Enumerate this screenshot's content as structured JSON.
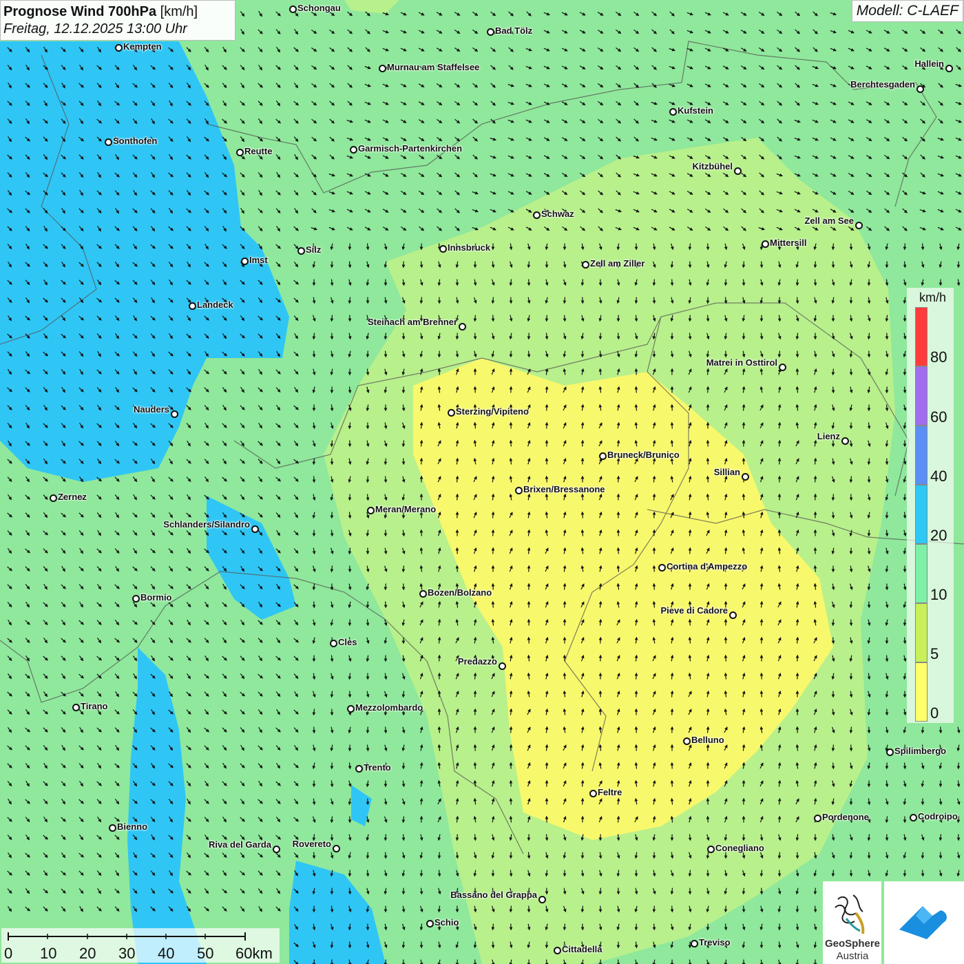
{
  "header": {
    "title": "Prognose Wind 700hPa",
    "unit": "[km/h]",
    "subtitle": "Freitag, 12.12.2025 13:00 Uhr",
    "model": "Modell: C-LAEF"
  },
  "legend": {
    "unit": "km/h",
    "ticks": [
      "80",
      "60",
      "40",
      "20",
      "10",
      "5",
      "0"
    ],
    "colors": [
      "#ff3b3b",
      "#a06cf0",
      "#5b8ff5",
      "#2ec8f5",
      "#7ef0a8",
      "#c8f05a",
      "#ffff6a"
    ]
  },
  "scale": {
    "labels": [
      "0",
      "10",
      "20",
      "30",
      "40",
      "50",
      "60km"
    ]
  },
  "logos": {
    "geosphere_line1": "GeoSphere",
    "geosphere_line2": "Austria",
    "geosphere_icon": "geosphere-logo-icon",
    "app_icon": "cloud-arrow-logo-icon"
  },
  "fields": {
    "colors": {
      "blue": "#2fc6f5",
      "green": "#8fe89b",
      "lightgreen": "#b8f08c",
      "yellow": "#f8f86c"
    }
  },
  "cities": [
    "Schongau",
    "Bad Tölz",
    "Kempten",
    "Murnau am Staffelsee",
    "Hallein",
    "Berchtesgaden",
    "Kufstein",
    "Sonthofen",
    "Reutte",
    "Garmisch-Partenkirchen",
    "Kitzbühel",
    "Schwaz",
    "Zell am See",
    "Silz",
    "Innsbruck",
    "Mittersill",
    "Imst",
    "Zell am Ziller",
    "Landeck",
    "Steinach am Brenner",
    "Matrei in Osttirol",
    "Nauders",
    "Sterzing/Vipiteno",
    "Lienz",
    "Bruneck/Brunico",
    "Sillian",
    "Brixen/Bressanone",
    "Zernez",
    "Meran/Merano",
    "Schlanders/Silandro",
    "Cortina d'Ampezzo",
    "Bozen/Bolzano",
    "Bormio",
    "Pieve di Cadore",
    "Cles",
    "Predazzo",
    "Tirano",
    "Mezzolombardo",
    "Belluno",
    "Spilimbergo",
    "Trento",
    "Feltre",
    "Pordenone",
    "Codroipo",
    "Bienno",
    "Riva del Garda",
    "Rovereto",
    "Conegliano",
    "Bassano del Grappa",
    "Schio",
    "Treviso",
    "Cittadella"
  ]
}
